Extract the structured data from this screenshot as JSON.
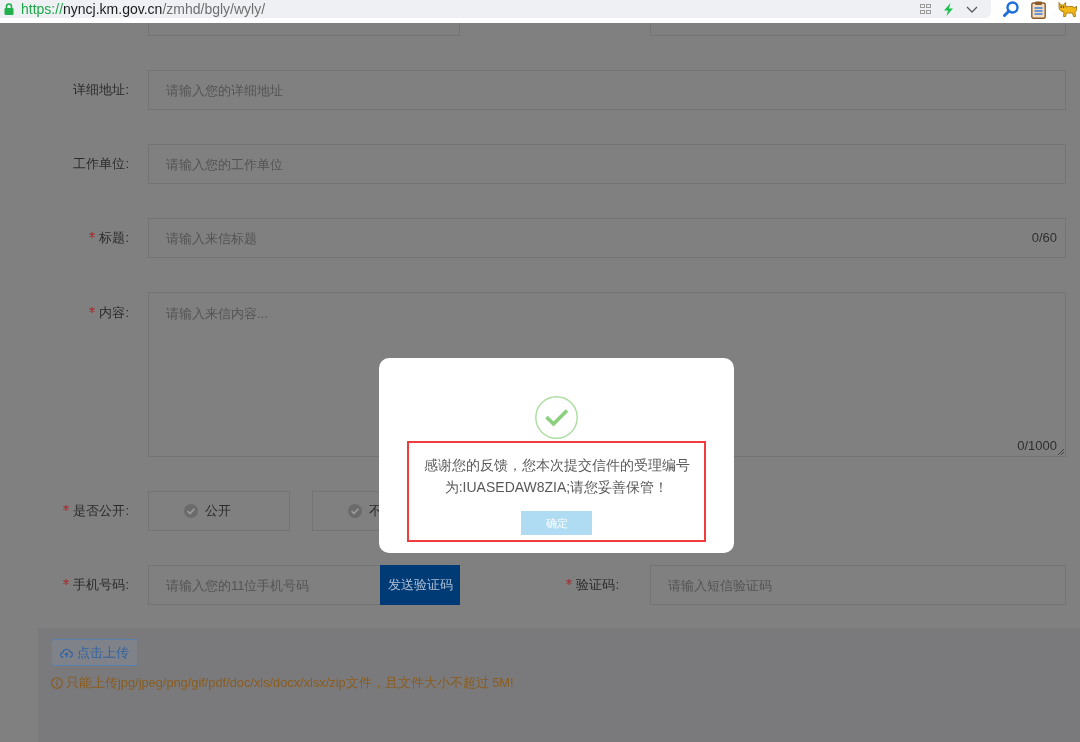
{
  "browser": {
    "url": {
      "scheme": "https://",
      "host": "nyncj.km.gov.cn",
      "path": "/zmhd/bgly/wyly/"
    }
  },
  "form": {
    "rows": [
      {
        "kind": "input",
        "label": "详细地址:",
        "required": false,
        "placeholder": "请输入您的详细地址"
      },
      {
        "kind": "input",
        "label": "工作单位:",
        "required": false,
        "placeholder": "请输入您的工作单位"
      },
      {
        "kind": "input",
        "label": "标题:",
        "required": true,
        "placeholder": "请输入来信标题",
        "counter": "0/60"
      },
      {
        "kind": "textarea",
        "label": "内容:",
        "required": true,
        "placeholder": "请输入来信内容...",
        "counter": "0/1000"
      },
      {
        "kind": "radio",
        "label": "是否公开:",
        "required": true,
        "options": [
          {
            "label": "公开",
            "selected": false
          },
          {
            "label": "不",
            "selected": false
          }
        ]
      },
      {
        "kind": "phone",
        "label": "手机号码:",
        "required": true,
        "placeholder": "请输入您的11位手机号码",
        "button": "发送验证码",
        "code_field": {
          "label": "验证码:",
          "required": true,
          "placeholder": "请输入短信验证码"
        }
      }
    ]
  },
  "upload": {
    "button": "点击上传",
    "note": "只能上传jpg/jpeg/png/gif/pdf/doc/xls/docx/xlsx/zip文件，且文件大小不超过 5M!"
  },
  "dialog": {
    "message": "感谢您的反馈，您本次提交信件的受理编号为:IUASEDAW8ZIA;请您妥善保管！",
    "button": "确定"
  }
}
